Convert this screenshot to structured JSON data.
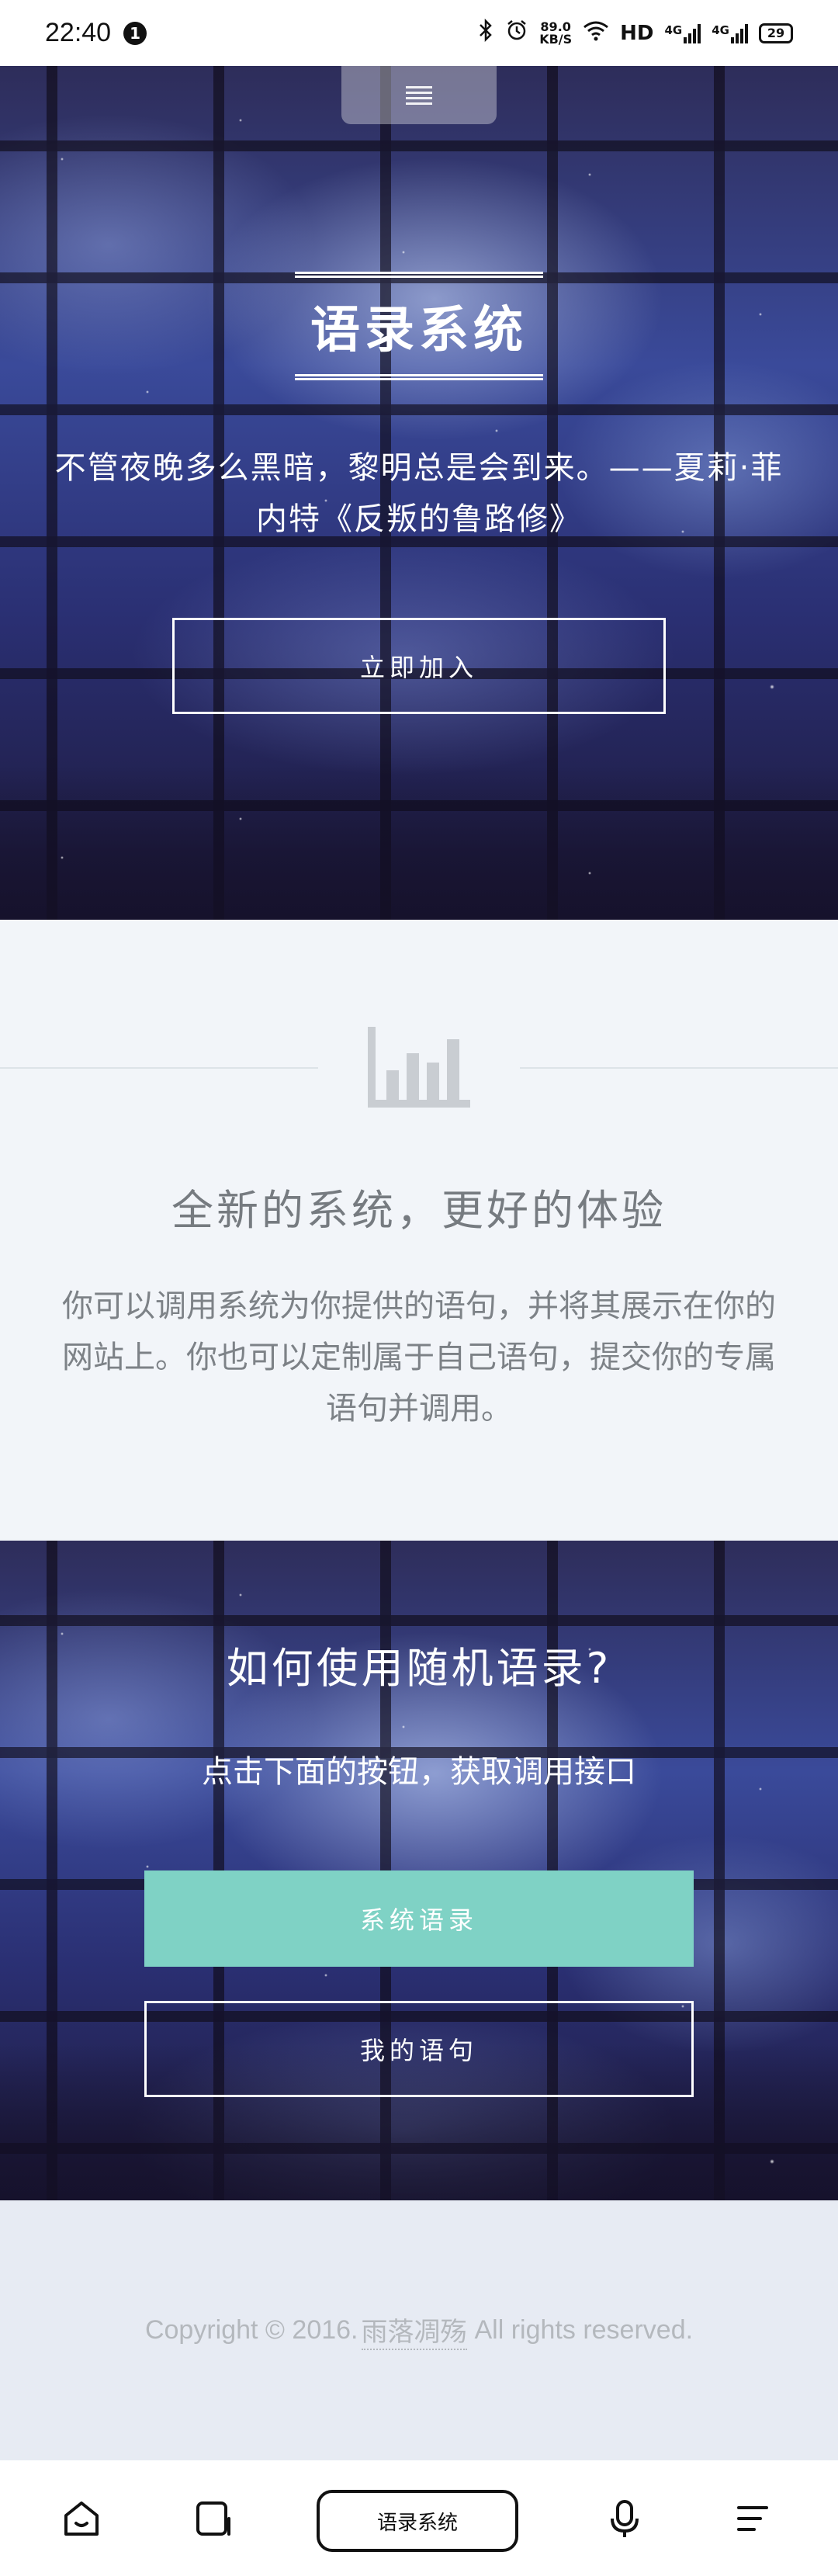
{
  "status_bar": {
    "time": "22:40",
    "notification_count": "1",
    "net_speed_value": "89.0",
    "net_speed_unit": "KB/S",
    "hd_label": "HD",
    "signal1": "4G",
    "signal2": "4G",
    "battery": "29"
  },
  "hero": {
    "title": "语录系统",
    "quote": "不管夜晚多么黑暗，黎明总是会到来。——夏莉·菲内特《反叛的鲁路修》",
    "join_button": "立即加入"
  },
  "features": {
    "icon": "bar-chart-icon",
    "heading": "全新的系统，更好的体验",
    "description": "你可以调用系统为你提供的语句，并将其展示在你的网站上。你也可以定制属于自己语句，提交你的专属语句并调用。"
  },
  "howto": {
    "heading": "如何使用随机语录?",
    "description": "点击下面的按钮，获取调用接口",
    "system_button": "系统语录",
    "mine_button": "我的语句"
  },
  "footer": {
    "copyright": "Copyright © 2016.",
    "author_link": "雨落凋殇",
    "rights": "All rights reserved."
  },
  "browser_bar": {
    "address_label": "语录系统",
    "icons": [
      "home-icon",
      "tabs-icon",
      "microphone-icon",
      "menu-icon"
    ]
  },
  "colors": {
    "accent": "#7fd2c5",
    "features_bg": "#f2f5f9",
    "footer_bg": "#e7ebf3"
  }
}
